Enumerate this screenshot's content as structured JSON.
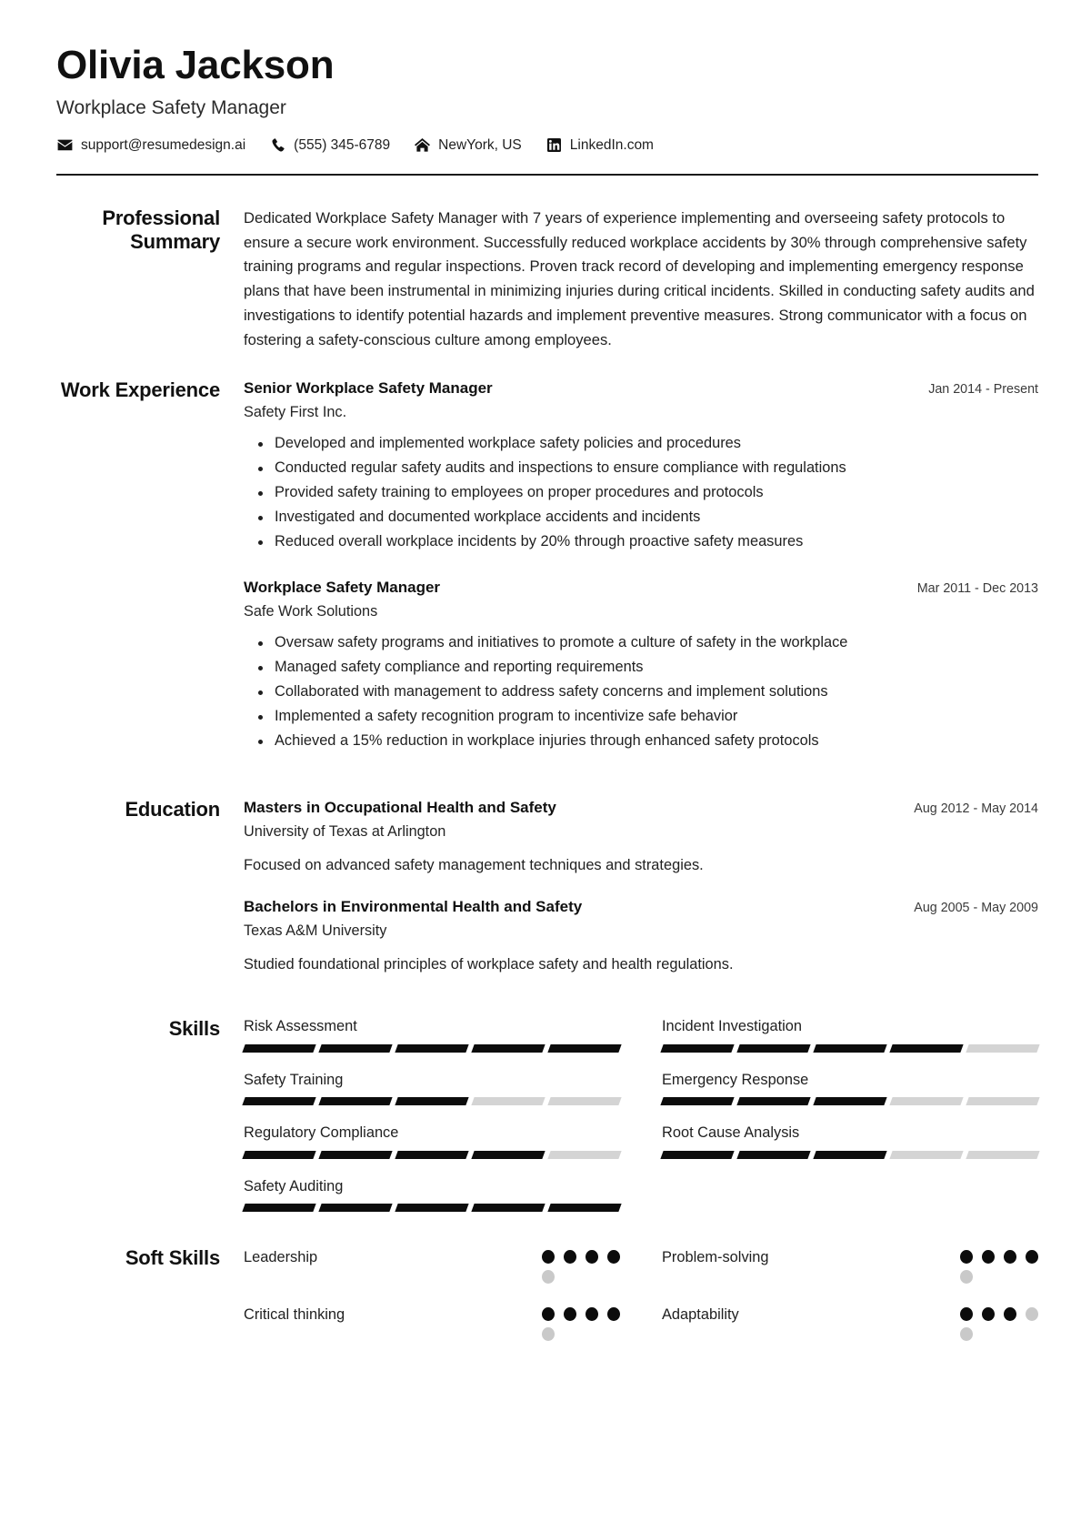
{
  "header": {
    "name": "Olivia Jackson",
    "role": "Workplace Safety Manager",
    "contacts": [
      {
        "icon": "envelope-icon",
        "text": "support@resumedesign.ai"
      },
      {
        "icon": "phone-icon",
        "text": "(555) 345-6789"
      },
      {
        "icon": "home-icon",
        "text": "NewYork, US"
      },
      {
        "icon": "linkedin-icon",
        "text": "LinkedIn.com"
      }
    ]
  },
  "sections": {
    "summary": {
      "label": "Professional Summary",
      "text": "Dedicated Workplace Safety Manager with 7 years of experience implementing and overseeing safety protocols to ensure a secure work environment. Successfully reduced workplace accidents by 30% through comprehensive safety training programs and regular inspections. Proven track record of developing and implementing emergency response plans that have been instrumental in minimizing injuries during critical incidents. Skilled in conducting safety audits and investigations to identify potential hazards and implement preventive measures. Strong communicator with a focus on fostering a safety-conscious culture among employees."
    },
    "experience": {
      "label": "Work Experience",
      "jobs": [
        {
          "title": "Senior Workplace Safety Manager",
          "org": "Safety First Inc.",
          "date": "Jan 2014 - Present",
          "bullets": [
            "Developed and implemented workplace safety policies and procedures",
            "Conducted regular safety audits and inspections to ensure compliance with regulations",
            "Provided safety training to employees on proper procedures and protocols",
            "Investigated and documented workplace accidents and incidents",
            "Reduced overall workplace incidents by 20% through proactive safety measures"
          ]
        },
        {
          "title": "Workplace Safety Manager",
          "org": "Safe Work Solutions",
          "date": "Mar 2011 - Dec 2013",
          "bullets": [
            "Oversaw safety programs and initiatives to promote a culture of safety in the workplace",
            "Managed safety compliance and reporting requirements",
            "Collaborated with management to address safety concerns and implement solutions",
            "Implemented a safety recognition program to incentivize safe behavior",
            "Achieved a 15% reduction in workplace injuries through enhanced safety protocols"
          ]
        }
      ]
    },
    "education": {
      "label": "Education",
      "entries": [
        {
          "degree": "Masters in Occupational Health and Safety",
          "school": "University of Texas at Arlington",
          "date": "Aug 2012 - May 2014",
          "desc": "Focused on advanced safety management techniques and strategies."
        },
        {
          "degree": "Bachelors in Environmental Health and Safety",
          "school": "Texas A&M University",
          "date": "Aug 2005 - May 2009",
          "desc": "Studied foundational principles of workplace safety and health regulations."
        }
      ]
    },
    "skills": {
      "label": "Skills",
      "max": 5,
      "items": [
        {
          "name": "Risk Assessment",
          "level": 5
        },
        {
          "name": "Incident Investigation",
          "level": 4
        },
        {
          "name": "Safety Training",
          "level": 3
        },
        {
          "name": "Emergency Response",
          "level": 3
        },
        {
          "name": "Regulatory Compliance",
          "level": 4
        },
        {
          "name": "Root Cause Analysis",
          "level": 3
        },
        {
          "name": "Safety Auditing",
          "level": 5
        }
      ]
    },
    "soft_skills": {
      "label": "Soft Skills",
      "max": 5,
      "items": [
        {
          "name": "Leadership",
          "level": 4
        },
        {
          "name": "Problem-solving",
          "level": 4
        },
        {
          "name": "Critical thinking",
          "level": 4
        },
        {
          "name": "Adaptability",
          "level": 3
        }
      ]
    }
  },
  "colors": {
    "text": "#1f1f1f",
    "filled": "#0c0c0c",
    "empty": "#d4d4d4",
    "rule": "#1a1a1a"
  }
}
